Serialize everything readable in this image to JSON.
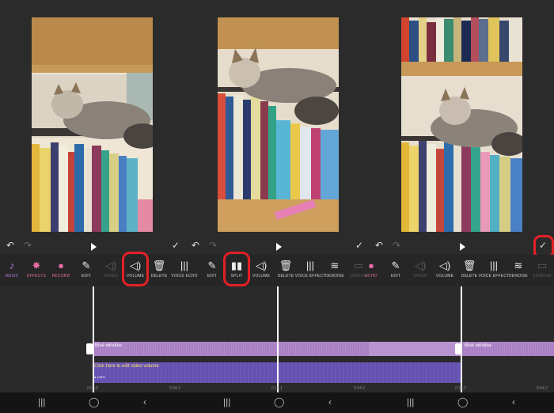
{
  "panes": [
    {
      "undo": "↶",
      "redo": "↷",
      "play": "play"
    },
    {
      "confirm": "✓",
      "undo": "↶",
      "redo": "↷",
      "play": "play"
    },
    {
      "confirm": "✓",
      "undo": "↶",
      "redo": "↷",
      "play": "play",
      "confirm_highlight": "✓"
    }
  ],
  "toolbar_left": [
    {
      "icon": "♪",
      "label": "MUSIC"
    },
    {
      "icon": "✸",
      "label": "EFFECTS"
    },
    {
      "icon": "●",
      "label": "RECORD"
    },
    {
      "icon": "✎",
      "label": "EDIT"
    },
    {
      "icon": "◁)",
      "label": "SPEED"
    },
    {
      "icon": "◁)",
      "label": "VOLUME"
    },
    {
      "icon": "🗑",
      "label": "DELETE"
    },
    {
      "icon": "|||",
      "label": "VOICE ECHO"
    }
  ],
  "toolbar_mid": [
    {
      "icon": "✎",
      "label": "EDIT"
    },
    {
      "icon": "▮▮",
      "label": "SPLIT"
    },
    {
      "icon": "◁)",
      "label": "VOLUME"
    },
    {
      "icon": "🗑",
      "label": "DELETE"
    },
    {
      "icon": "|||",
      "label": "VOICE EFFECT"
    },
    {
      "icon": "≋",
      "label": "DENOISE"
    }
  ],
  "toolbar_right": [
    {
      "icon": "▭",
      "label": "SHADOW"
    },
    {
      "icon": "●",
      "label": "ECHO"
    },
    {
      "icon": "✎",
      "label": "EDIT"
    },
    {
      "icon": "◁)",
      "label": "SPEED"
    },
    {
      "icon": "◁)",
      "label": "VOLUME"
    },
    {
      "icon": "🗑",
      "label": "DELETE"
    },
    {
      "icon": "|||",
      "label": "VOICE EFFECT"
    },
    {
      "icon": "≋",
      "label": "DENOISE"
    },
    {
      "icon": "▭",
      "label": "SHADOW"
    }
  ],
  "timeline": {
    "music_label_1": "Blue window",
    "music_label_2": "Blue window",
    "video_label": "Click here to edit video volume",
    "video_sub": "● 100%",
    "ticks": [
      "0:00.0",
      "0:34.2",
      "0:18.1",
      "0:34.2",
      "0:34.2",
      "0:34.2"
    ]
  },
  "navbar": {
    "recents": "|||",
    "home": "◯",
    "back": "‹"
  },
  "colors": {
    "accent_red": "#e41f26",
    "music_track": "#b48acc",
    "video_track": "#6a57b8"
  }
}
